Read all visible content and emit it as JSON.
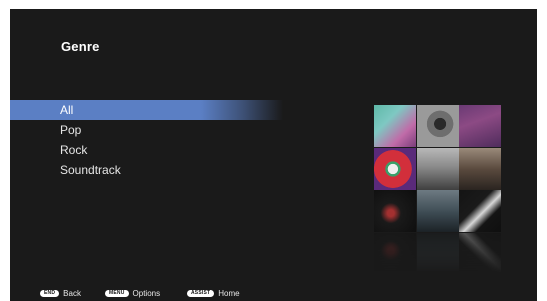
{
  "screen": {
    "title": "Genre",
    "colors": {
      "background": "#1a1a1a",
      "selection": "#5b7fc4",
      "text": "#e6e6e6"
    }
  },
  "menu": {
    "selected_index": 0,
    "items": [
      {
        "label": "All"
      },
      {
        "label": "Pop"
      },
      {
        "label": "Rock"
      },
      {
        "label": "Soundtrack"
      }
    ]
  },
  "album_art": {
    "tiles": [
      "album-1",
      "album-2",
      "album-3",
      "album-4",
      "album-5",
      "album-6",
      "album-7",
      "album-8",
      "album-9"
    ]
  },
  "footer": {
    "back": {
      "key": "END",
      "label": "Back"
    },
    "options": {
      "key": "MENU",
      "label": "Options"
    },
    "home": {
      "key": "ASSIST",
      "label": "Home"
    }
  }
}
